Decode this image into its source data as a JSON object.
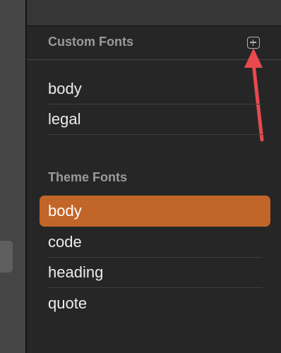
{
  "custom_fonts": {
    "header": "Custom Fonts",
    "items": [
      {
        "label": "body"
      },
      {
        "label": "legal"
      }
    ]
  },
  "theme_fonts": {
    "header": "Theme Fonts",
    "items": [
      {
        "label": "body",
        "selected": true
      },
      {
        "label": "code"
      },
      {
        "label": "heading"
      },
      {
        "label": "quote"
      }
    ]
  },
  "icons": {
    "add": "plus-square-icon",
    "annotation": "red-arrow-icon"
  },
  "colors": {
    "accent": "#c26528",
    "annotation": "#e84a4f"
  }
}
